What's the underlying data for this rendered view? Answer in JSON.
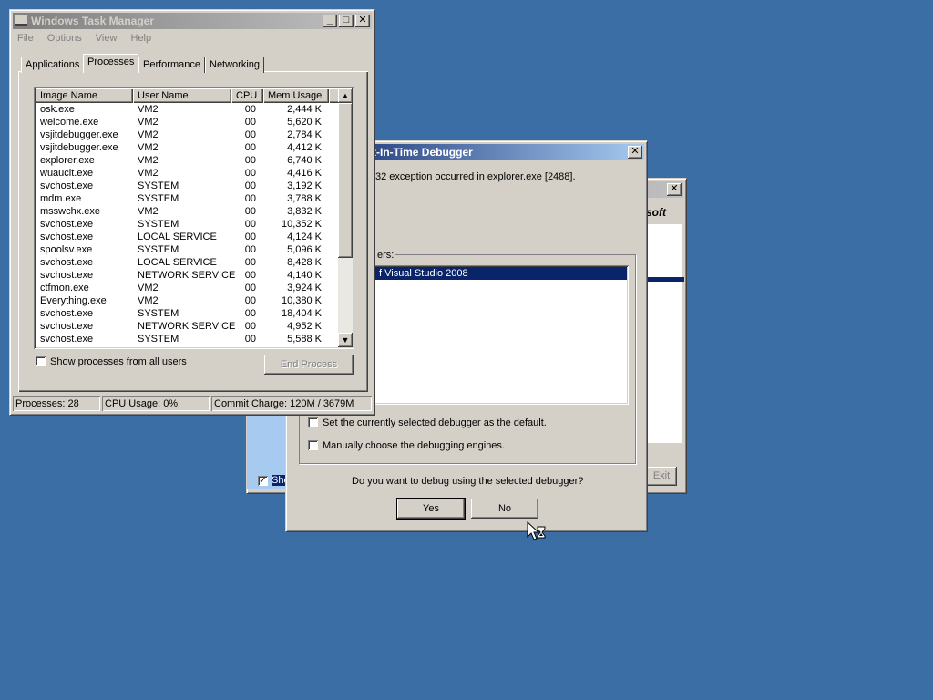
{
  "back_window": {
    "logo_fragment": "soft",
    "close_glyph": "✕",
    "checkbox_label_fragment": "Sho",
    "exit_label": "Exit"
  },
  "debugger_dialog": {
    "title": "t-In-Time Debugger",
    "close_glyph": "✕",
    "exception_text": "32 exception occurred in explorer.exe [2488].",
    "group_label": "ers:",
    "debuggers": [
      "f Visual Studio 2008"
    ],
    "set_default_label": "Set the currently selected debugger as the default.",
    "manual_engines_label": "Manually choose the debugging engines.",
    "question": "Do you want to debug using the selected debugger?",
    "yes_label": "Yes",
    "no_label": "No"
  },
  "task_manager": {
    "title": "Windows Task Manager",
    "title_buttons": {
      "minimize": "_",
      "maximize": "□",
      "close": "✕"
    },
    "menu": [
      "File",
      "Options",
      "View",
      "Help"
    ],
    "tabs": [
      "Applications",
      "Processes",
      "Performance",
      "Networking"
    ],
    "active_tab": "Processes",
    "columns": [
      "Image Name",
      "User Name",
      "CPU",
      "Mem Usage"
    ],
    "processes": [
      {
        "name": "osk.exe",
        "user": "VM2",
        "cpu": "00",
        "mem": "2,444 K"
      },
      {
        "name": "welcome.exe",
        "user": "VM2",
        "cpu": "00",
        "mem": "5,620 K"
      },
      {
        "name": "vsjitdebugger.exe",
        "user": "VM2",
        "cpu": "00",
        "mem": "2,784 K"
      },
      {
        "name": "vsjitdebugger.exe",
        "user": "VM2",
        "cpu": "00",
        "mem": "4,412 K"
      },
      {
        "name": "explorer.exe",
        "user": "VM2",
        "cpu": "00",
        "mem": "6,740 K"
      },
      {
        "name": "wuauclt.exe",
        "user": "VM2",
        "cpu": "00",
        "mem": "4,416 K"
      },
      {
        "name": "svchost.exe",
        "user": "SYSTEM",
        "cpu": "00",
        "mem": "3,192 K"
      },
      {
        "name": "mdm.exe",
        "user": "SYSTEM",
        "cpu": "00",
        "mem": "3,788 K"
      },
      {
        "name": "msswchx.exe",
        "user": "VM2",
        "cpu": "00",
        "mem": "3,832 K"
      },
      {
        "name": "svchost.exe",
        "user": "SYSTEM",
        "cpu": "00",
        "mem": "10,352 K"
      },
      {
        "name": "svchost.exe",
        "user": "LOCAL SERVICE",
        "cpu": "00",
        "mem": "4,124 K"
      },
      {
        "name": "spoolsv.exe",
        "user": "SYSTEM",
        "cpu": "00",
        "mem": "5,096 K"
      },
      {
        "name": "svchost.exe",
        "user": "LOCAL SERVICE",
        "cpu": "00",
        "mem": "8,428 K"
      },
      {
        "name": "svchost.exe",
        "user": "NETWORK SERVICE",
        "cpu": "00",
        "mem": "4,140 K"
      },
      {
        "name": "ctfmon.exe",
        "user": "VM2",
        "cpu": "00",
        "mem": "3,924 K"
      },
      {
        "name": "Everything.exe",
        "user": "VM2",
        "cpu": "00",
        "mem": "10,380 K"
      },
      {
        "name": "svchost.exe",
        "user": "SYSTEM",
        "cpu": "00",
        "mem": "18,404 K"
      },
      {
        "name": "svchost.exe",
        "user": "NETWORK SERVICE",
        "cpu": "00",
        "mem": "4,952 K"
      },
      {
        "name": "svchost.exe",
        "user": "SYSTEM",
        "cpu": "00",
        "mem": "5,588 K"
      }
    ],
    "scroll_up_glyph": "▲",
    "scroll_down_glyph": "▼",
    "show_all_users_label": "Show processes from all users",
    "end_process_label": "End Process",
    "status": {
      "processes": "Processes: 28",
      "cpu": "CPU Usage: 0%",
      "commit": "Commit Charge: 120M / 3679M"
    }
  },
  "colors": {
    "desktop": "#3a6ea5",
    "title_active": "#0a246a",
    "face": "#d4d0c8",
    "selection": "#0a246a"
  }
}
